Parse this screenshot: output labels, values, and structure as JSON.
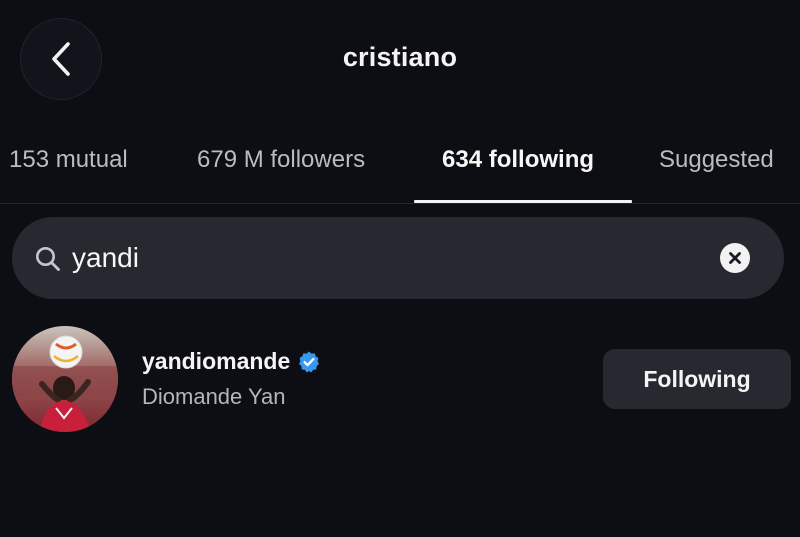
{
  "header": {
    "title": "cristiano"
  },
  "tabs": [
    {
      "label": "153 mutual"
    },
    {
      "label": "679 M followers"
    },
    {
      "label": "634 following"
    },
    {
      "label": "Suggested"
    }
  ],
  "active_tab": "634 following",
  "search": {
    "value": "yandi"
  },
  "results": [
    {
      "username": "yandiomande",
      "full_name": "Diomande Yan",
      "verified": true,
      "button_label": "Following"
    }
  ],
  "colors": {
    "background": "#0c0e14",
    "field": "#262930",
    "verified_badge": "#3897f0"
  },
  "icons": {
    "back": "chevron-left-icon",
    "search": "search-icon",
    "clear": "clear-x-icon",
    "verified": "verified-badge-icon"
  }
}
